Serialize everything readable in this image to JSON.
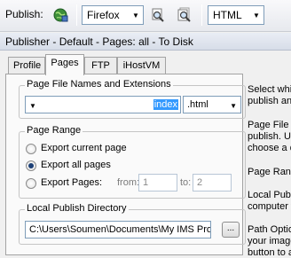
{
  "toolbar": {
    "publish_label": "Publish:",
    "browser_value": "Firefox",
    "format_value": "HTML"
  },
  "window": {
    "title": "Publisher - Default - Pages: all - To Disk"
  },
  "tabs": [
    {
      "label": "Profile",
      "active": false
    },
    {
      "label": "Pages",
      "active": true
    },
    {
      "label": "FTP",
      "active": false
    },
    {
      "label": "iHostVM",
      "active": false
    }
  ],
  "file_names": {
    "legend": "Page File Names and Extensions",
    "name_value": "index",
    "extension_value": ".html"
  },
  "page_range": {
    "legend": "Page Range",
    "options": [
      {
        "label": "Export current page",
        "selected": false
      },
      {
        "label": "Export all pages",
        "selected": true
      },
      {
        "label": "Export Pages:",
        "selected": false
      }
    ],
    "from_label": "from:",
    "from_value": "1",
    "to_label": "to:",
    "to_value": "2"
  },
  "local_dir": {
    "legend": "Local Publish Directory",
    "path_value": "C:\\Users\\Soumen\\Documents\\My IMS Pro",
    "browse_label": "..."
  },
  "help_lines": [
    "Select whi",
    "publish and",
    "Page File N",
    "publish. Us",
    "choose a d",
    "Page Rang",
    "Local Publi",
    "computer y",
    "Path Optio",
    "your image",
    "button to a"
  ]
}
